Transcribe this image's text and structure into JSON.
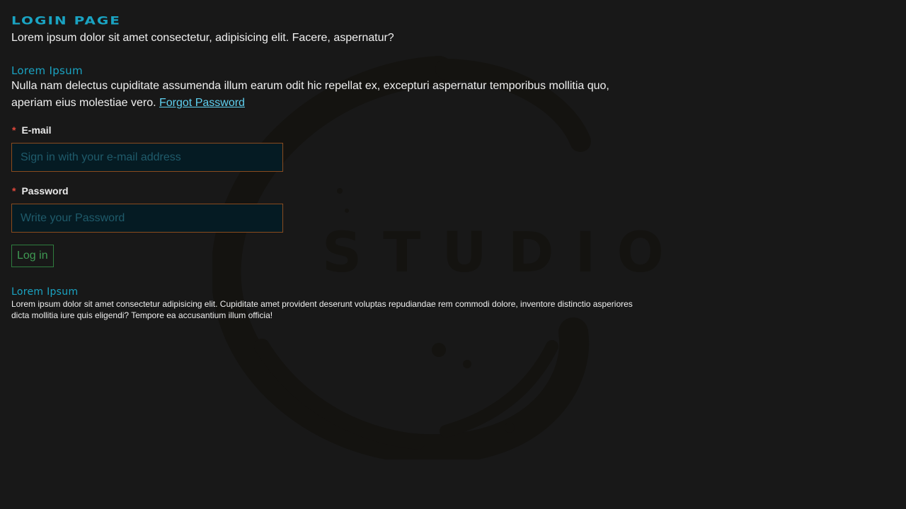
{
  "page": {
    "title": "Login Page",
    "subtitle": "Lorem ipsum dolor sit amet consectetur, adipisicing elit. Facere, aspernatur?"
  },
  "intro": {
    "heading": "Lorem Ipsum",
    "text": "Nulla nam delectus cupiditate assumenda illum earum odit hic repellat ex, excepturi aspernatur temporibus mollitia quo, aperiam eius molestiae vero.",
    "forgot_link": "Forgot Password"
  },
  "form": {
    "email": {
      "required_mark": "*",
      "label": "E-mail",
      "placeholder": "Sign in with your e-mail address",
      "value": ""
    },
    "password": {
      "required_mark": "*",
      "label": "Password",
      "placeholder": "Write your Password",
      "value": ""
    },
    "submit_label": "Log in"
  },
  "footer": {
    "heading": "Lorem Ipsum",
    "text": "Lorem ipsum dolor sit amet consectetur adipisicing elit. Cupiditate amet provident deserunt voluptas repudiandae rem commodi dolore, inventore distinctio asperiores dicta mollitia iure quis eligendi? Tempore ea accusantium illum officia!"
  },
  "watermark": {
    "text": "STUDIO",
    "icon": "brush-circle-logo"
  },
  "colors": {
    "background": "#181818",
    "accent": "#1aa3c2",
    "link": "#5fd0f0",
    "required": "#e0483c",
    "input_border": "#8a4b1e",
    "input_bg": "#051b23",
    "button": "#3f9a53"
  }
}
